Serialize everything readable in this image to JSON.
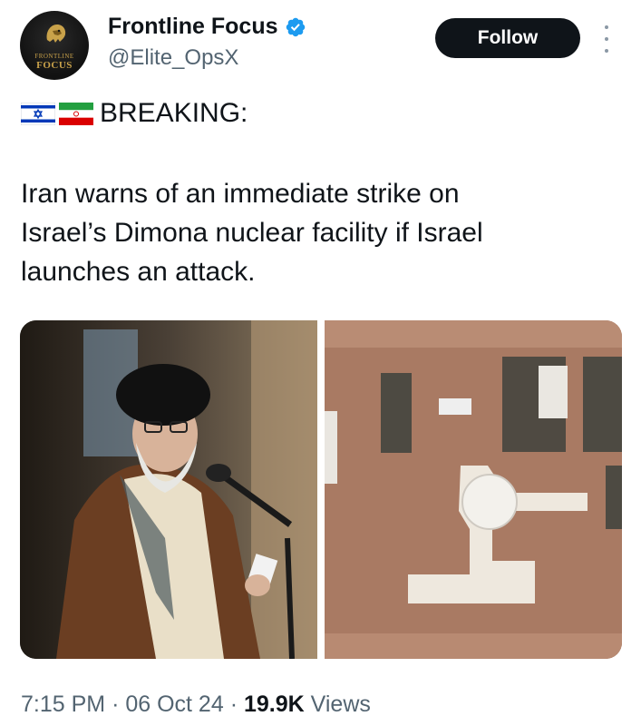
{
  "account": {
    "display_name": "Frontline Focus",
    "handle": "@Elite_OpsX",
    "avatar_text_top": "FRONTLINE",
    "avatar_text_bottom": "FOCUS",
    "verified": true
  },
  "actions": {
    "follow_label": "Follow",
    "more_icon": "more-vertical-icon"
  },
  "tweet": {
    "flags": [
      "israel-flag",
      "iran-flag"
    ],
    "headline": "BREAKING:",
    "lines": [
      "Iran warns of an immediate strike on",
      "Israel’s Dimona nuclear facility if Israel",
      "launches an attack."
    ]
  },
  "media": {
    "images": [
      "photo of cleric speaking at microphone",
      "aerial satellite view of facility"
    ]
  },
  "meta": {
    "time": "7:15 PM",
    "date": "06 Oct 24",
    "views_count": "19.9K",
    "views_label": "Views",
    "separator": "·"
  },
  "colors": {
    "text": "#0f1419",
    "secondary": "#536471",
    "verified_blue": "#1d9bf0",
    "button_bg": "#0f1419"
  }
}
